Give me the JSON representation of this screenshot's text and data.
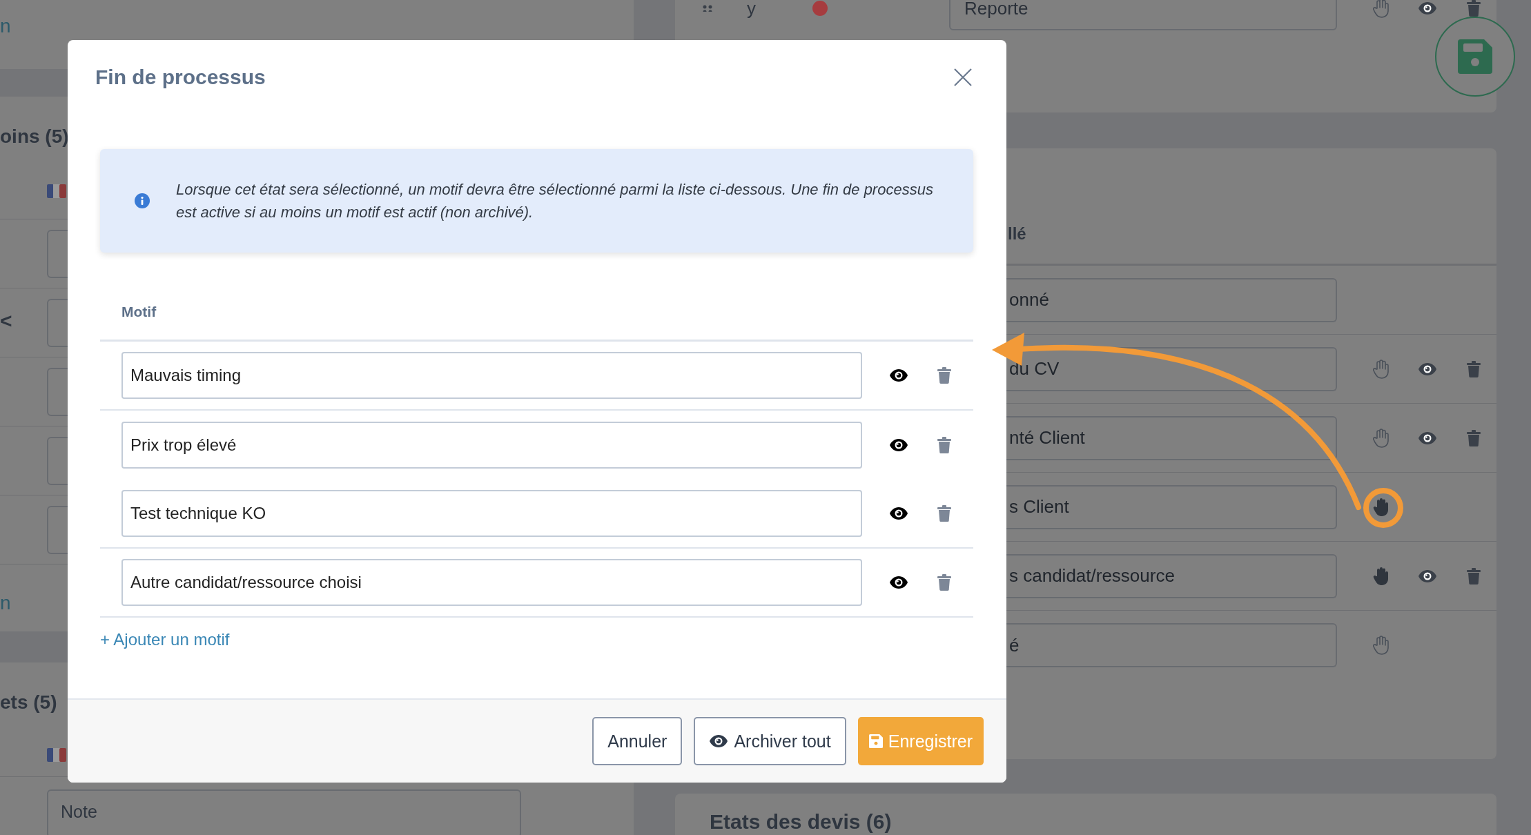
{
  "background": {
    "left_panel": {
      "link_top": "n",
      "section_1_title": "oins (5)",
      "chevron": "<",
      "link_bottom": "n",
      "section_2_title": "ets (5)",
      "note_field": "Note"
    },
    "right_panel": {
      "top_row": {
        "label": "y",
        "value": "Reporte",
        "hand_visible": true,
        "hand_filled": false,
        "archivable": true
      },
      "column_header": "llé",
      "rows": [
        {
          "value": "onné",
          "hand_visible": false,
          "archivable": false
        },
        {
          "value": "du CV",
          "hand_visible": true,
          "hand_filled": false,
          "archivable": true
        },
        {
          "value": "nté Client",
          "hand_visible": true,
          "hand_filled": false,
          "archivable": true
        },
        {
          "value": "s Client",
          "hand_visible": true,
          "hand_filled": true,
          "archivable": false
        },
        {
          "value": "s candidat/ressource",
          "hand_visible": true,
          "hand_filled": true,
          "archivable": true
        },
        {
          "value": "é",
          "hand_visible": true,
          "hand_filled": false,
          "archivable": false
        }
      ],
      "section_title": "Etats des devis (6)"
    }
  },
  "modal": {
    "title": "Fin de processus",
    "info": "Lorsque cet état sera sélectionné, un motif devra être sélectionné parmi la liste ci-dessous. Une fin de processus est active si au moins un motif est actif (non archivé).",
    "column_header": "Motif",
    "motifs": [
      {
        "value": "Mauvais timing",
        "archived": false
      },
      {
        "value": "Prix trop élevé",
        "archived": false
      },
      {
        "value": "Test technique KO",
        "archived": false
      },
      {
        "value": "Autre candidat/ressource choisi",
        "archived": false
      }
    ],
    "add_link": "+ Ajouter un motif",
    "buttons": [
      {
        "label": "Annuler",
        "kind": "cancel"
      },
      {
        "label": "Archiver tout",
        "kind": "archive"
      },
      {
        "label": "Enregistrer",
        "kind": "save"
      }
    ]
  }
}
